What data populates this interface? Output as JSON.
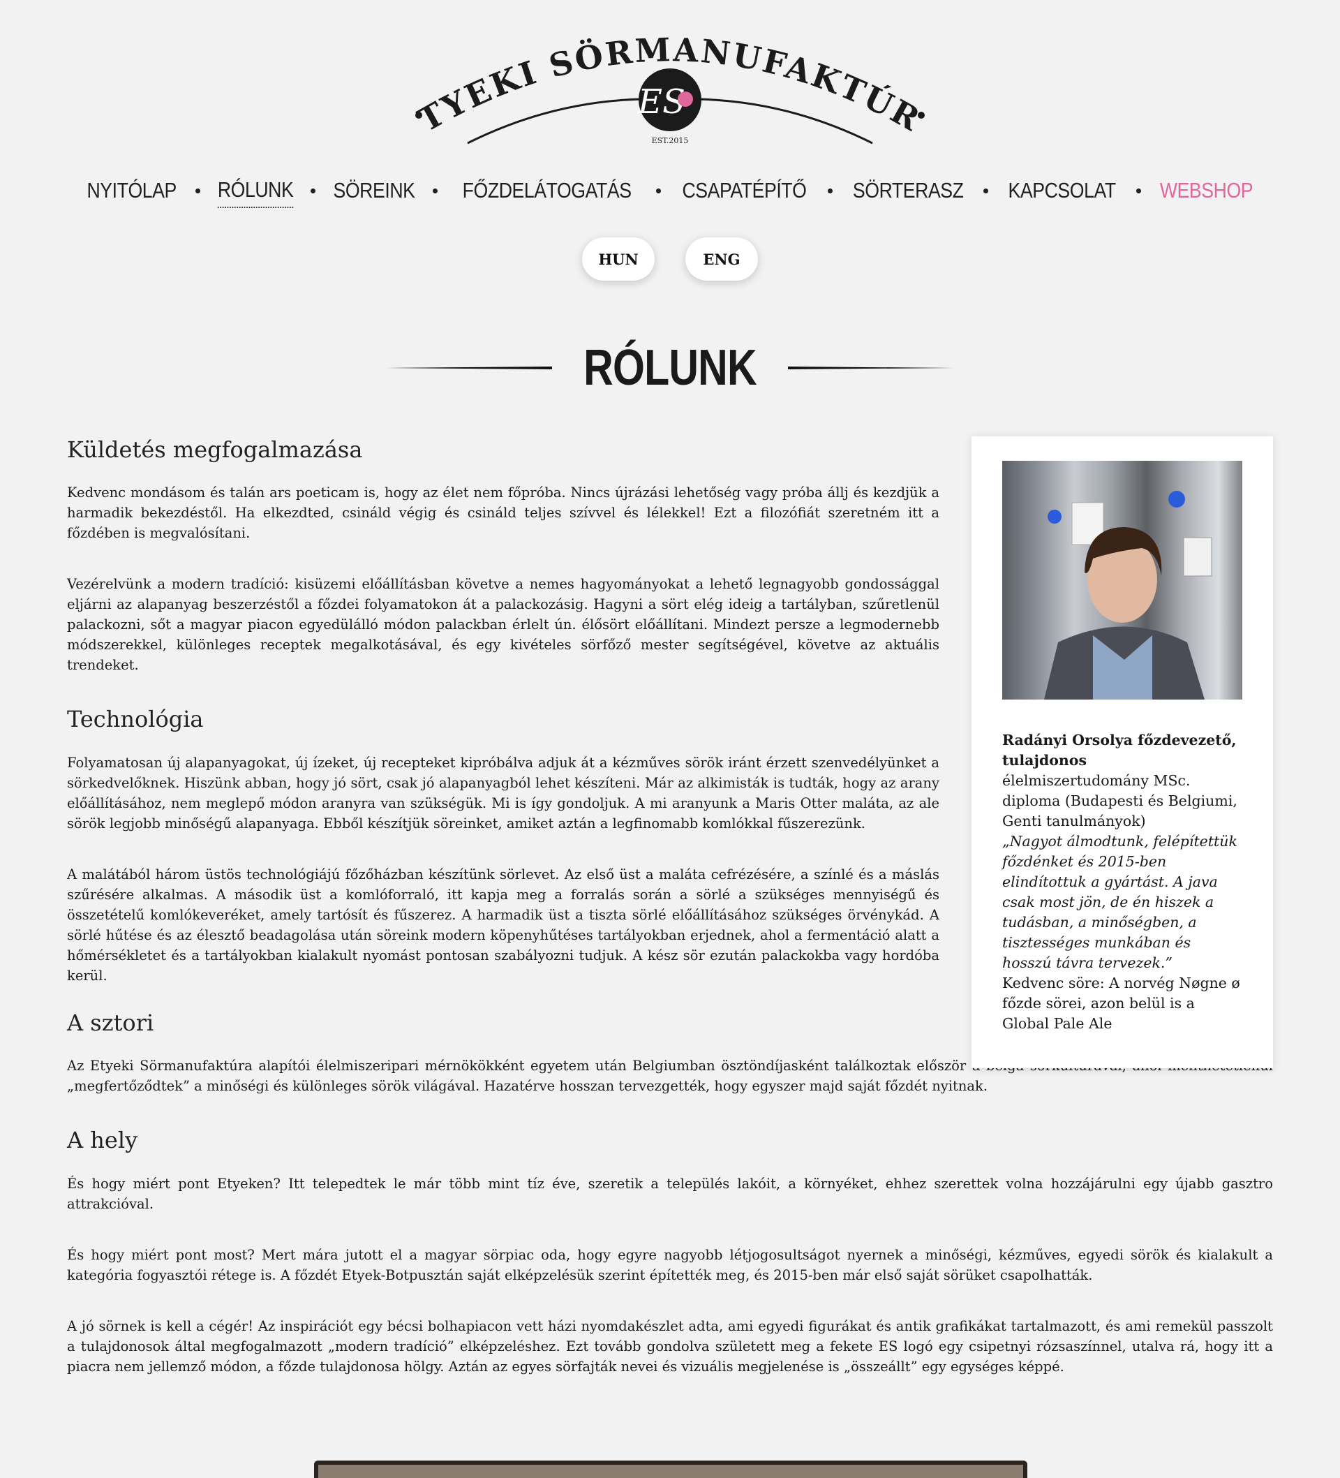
{
  "brand": {
    "name": "ETYEKI SÖRMANUFAKTÚRA",
    "monogram": "ES",
    "est": "EST.2015"
  },
  "nav": {
    "items": [
      {
        "label": "NYITÓLAP"
      },
      {
        "label": "RÓLUNK"
      },
      {
        "label": "SÖREINK"
      },
      {
        "label": "FŐZDELÁTOGATÁS"
      },
      {
        "label": "CSAPATÉPÍTŐ"
      },
      {
        "label": "SÖRTERASZ"
      },
      {
        "label": "KAPCSOLAT"
      },
      {
        "label": "WEBSHOP"
      }
    ],
    "active": "RÓLUNK",
    "accent_color": "#e0679b"
  },
  "lang": {
    "hun": "HUN",
    "eng": "ENG"
  },
  "page_title": "RÓLUNK",
  "sections": {
    "mission": {
      "heading": "Küldetés megfogalmazása",
      "p1": "Kedvenc mondásom és talán ars poeticam is, hogy az élet nem főpróba. Nincs újrázási lehetőség vagy próba állj és kezdjük a harmadik bekezdéstől. Ha elkezdted, csináld végig és csináld teljes szívvel és lélekkel! Ezt a filozófiát szeretném itt a főzdében is megvalósítani.",
      "p2": "Vezérelvünk a modern tradíció: kisüzemi előállításban követve a nemes hagyományokat a lehető legnagyobb gondossággal eljárni az alapanyag beszerzéstől a főzdei folyamatokon át a palackozásig. Hagyni a sört elég ideig a tartályban, szűretlenül palackozni, sőt  a magyar piacon egyedülálló módon palackban érlelt ún. élősört előállítani. Mindezt persze a legmodernebb módszerekkel, különleges receptek megalkotásával, és egy kivételes sörfőző mester segítségével, követve az aktuális trendeket."
    },
    "tech": {
      "heading": "Technológia",
      "p1": "Folyamatosan új alapanyagokat, új ízeket, új recepteket kipróbálva adjuk át a kézműves sörök iránt érzett szenvedélyünket a sörkedvelőknek. Hiszünk abban, hogy jó sört, csak jó alapanyagból lehet készíteni. Már az alkimisták is tudták, hogy az arany előállításához, nem meglepő módon aranyra van szükségük. Mi is így gondoljuk.  A mi aranyunk a Maris Otter maláta, az ale sörök legjobb minőségű alapanyaga. Ebből készítjük söreinket, amiket aztán a legfinomabb komlókkal fűszerezünk.",
      "p2": "A malátából három üstös technológiájú főzőházban készítünk sörlevet. Az első üst a maláta cefrézésére, a színlé és a máslás szűrésére alkalmas. A második üst a komlóforraló, itt kapja meg a forralás során a sörlé a szükséges mennyiségű és összetételű komlókeveréket, amely tartósít és fűszerez. A harmadik üst a tiszta sörlé előállításához szükséges örvénykád. A sörlé hűtése és az élesztő beadagolása után söreink modern köpenyhűtéses tartályokban erjednek, ahol a fermentáció alatt a hőmérsékletet és a tartályokban kialakult nyomást pontosan szabályozni tudjuk. A kész sör ezután palackokba vagy hordóba kerül."
    },
    "story": {
      "heading": "A sztori",
      "p1": "Az Etyeki Sörmanufaktúra alapítói élelmiszeripari mérnökökként egyetem után Belgiumban ösztöndíjasként találkoztak először a belga sörkultúrával, ahol menthetetlenül „megfertőződtek” a minőségi és különleges sörök világával. Hazatérve hosszan tervezgették, hogy egyszer majd saját főzdét nyitnak."
    },
    "place": {
      "heading": "A hely",
      "p1": "És hogy miért pont Etyeken? Itt telepedtek le már több mint tíz éve, szeretik a település lakóit, a környéket, ehhez szerettek volna hozzájárulni egy újabb gasztro attrakcióval.",
      "p2": "És hogy miért pont most? Mert mára jutott el a magyar sörpiac oda, hogy egyre nagyobb létjogosultságot nyernek a minőségi, kézműves, egyedi sörök és kialakult a kategória fogyasztói rétege is. A főzdét Etyek-Botpusztán saját elképzelésük szerint építették meg, és 2015-ben már első saját sörüket csapolhatták.",
      "p3": "A jó sörnek is kell a cégér! Az inspirációt egy bécsi bolhapiacon vett házi nyomdakészlet adta, ami egyedi figurákat és antik grafikákat tartalmazott, és ami remekül passzolt a tulajdonosok által megfogalmazott „modern tradíció” elképzeléshez. Ezt tovább gondolva született meg a fekete ES logó egy csipetnyi rózsaszínnel, utalva rá, hogy itt a piacra nem jellemző módon, a főzde tulajdonosa hölgy. Aztán az egyes sörfajták nevei és vizuális megjelenése is „összeállt” egy egységes képpé."
    }
  },
  "sidebar": {
    "name": "Radányi Orsolya főzdevezető, tulajdonos",
    "degree": "élelmiszertudomány MSc. diploma (Budapesti és Belgiumi, Genti tanulmányok)",
    "quote": "„Nagyot álmodtunk, felépítettük főzdénket és 2015-ben elindítottuk a gyártást. A java csak most jön, de én hiszek a tudásban, a minőségben, a tisztességes munkában és hosszú távra tervezek.”",
    "favorite": "Kedvenc söre: A norvég Nøgne ø főzde sörei, azon belül is a Global Pale Ale"
  }
}
